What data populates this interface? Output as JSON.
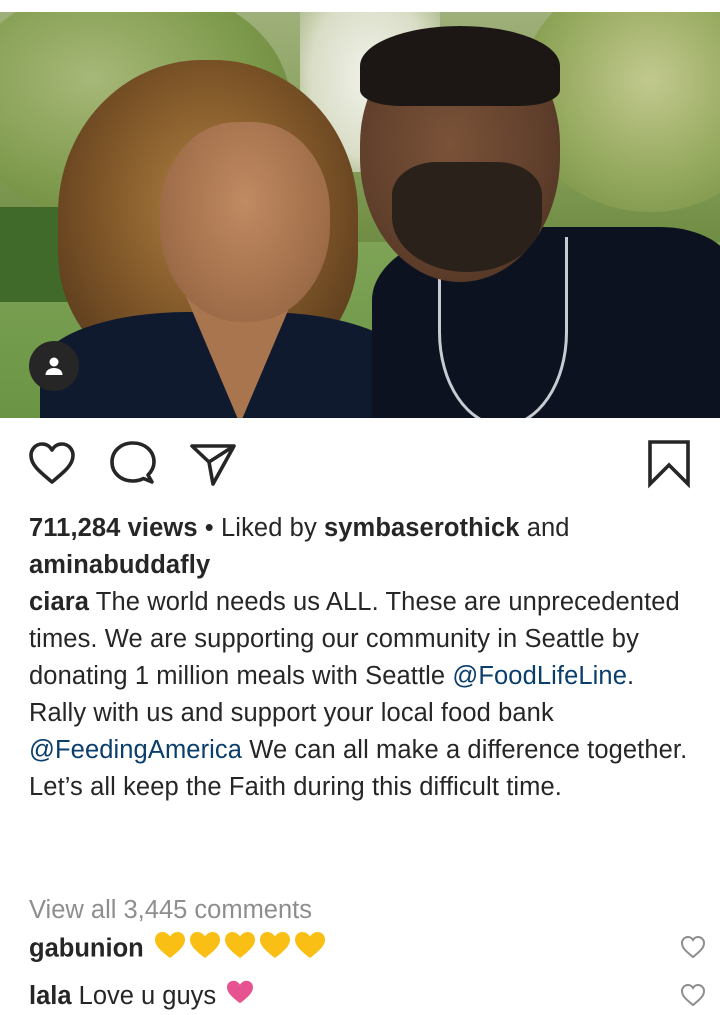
{
  "post": {
    "user_tag_icon": "person-icon"
  },
  "actions": {
    "like_icon": "heart-outline-icon",
    "comment_icon": "speech-bubble-icon",
    "share_icon": "paper-plane-icon",
    "save_icon": "bookmark-icon"
  },
  "stats": {
    "views": "711,284 views",
    "separator": " • Liked by ",
    "liker1": "symbaserothick",
    "and": " and",
    "liker2": "aminabuddafly"
  },
  "caption": {
    "username": "ciara",
    "text1": " The world needs us ALL. These are unprecedented times. We are supporting our community in Seattle by donating 1 million meals with Seattle ",
    "mention1": "@FoodLifeLine",
    "text2": ".",
    "text3": "Rally with us and support your local food bank ",
    "mention2": "@FeedingAmerica",
    "text4": " We can all make a difference together. Let’s all keep the Faith during this difficult time."
  },
  "view_all_comments": "View all 3,445 comments",
  "comments": [
    {
      "username": "gabunion",
      "text": "",
      "emoji": "yellow-heart x5"
    },
    {
      "username": "lala",
      "text": " Love u guys ",
      "emoji": "pink-heart"
    }
  ],
  "colors": {
    "text": "#262626",
    "link": "#0a3e6d",
    "muted": "#8e8e8e",
    "yellow_heart": "#f9bf15",
    "pink_heart": "#e75391"
  }
}
